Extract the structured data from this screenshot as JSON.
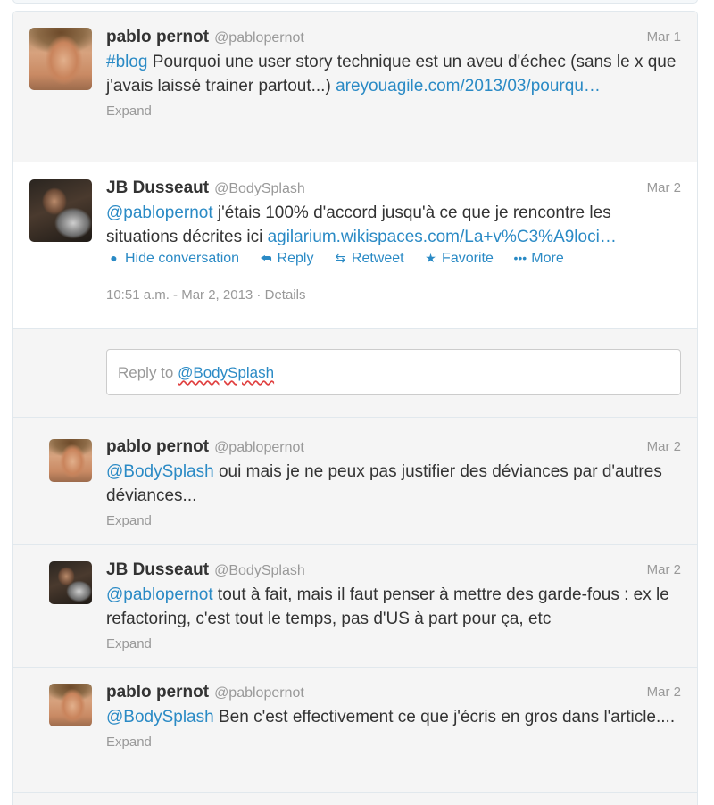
{
  "tweets": [
    {
      "fullname": "pablo pernot",
      "username": "@pablopernot",
      "date": "Mar 1",
      "text_parts": [
        "#blog",
        " Pourquoi une user story technique est un aveu d'échec (sans le x que j'avais laissé trainer partout...) ",
        "areyouagile.com/2013/03/pourqu…"
      ],
      "expand": "Expand"
    },
    {
      "fullname": "JB Dusseaut",
      "username": "@BodySplash",
      "date": "Mar 2",
      "text_parts": [
        "@pablopernot",
        " j'étais 100% d'accord jusqu'à ce que je rencontre les situations décrites ici ",
        "agilarium.wikispaces.com/La+v%C3%A9loci…"
      ],
      "actions": {
        "hide_conversation": "Hide conversation",
        "reply": "Reply",
        "retweet": "Retweet",
        "favorite": "Favorite",
        "more": "More"
      },
      "timestamp": "10:51 a.m. - Mar 2, 2013",
      "details": "Details"
    },
    {
      "fullname": "pablo pernot",
      "username": "@pablopernot",
      "date": "Mar 2",
      "text_parts": [
        "@BodySplash",
        " oui mais je ne peux pas justifier des déviances par d'autres déviances..."
      ],
      "expand": "Expand"
    },
    {
      "fullname": "JB Dusseaut",
      "username": "@BodySplash",
      "date": "Mar 2",
      "text_parts": [
        "@pablopernot",
        " tout à fait, mais il faut penser à mettre des garde-fous : ex le refactoring, c'est tout le temps, pas d'US à part pour ça, etc"
      ],
      "expand": "Expand"
    },
    {
      "fullname": "pablo pernot",
      "username": "@pablopernot",
      "date": "Mar 2",
      "text_parts": [
        "@BodySplash",
        " Ben c'est effectivement ce que j'écris en gros dans l'article...."
      ],
      "expand": "Expand"
    }
  ],
  "reply_box": {
    "prefix": "Reply to ",
    "mention": "@BodySplash"
  },
  "colors": {
    "link": "#2a8ac5",
    "muted": "#999999",
    "text": "#333333",
    "border": "#e1e8ed",
    "grey_bg": "#f5f5f5"
  },
  "icons": {
    "hide_conversation": "speech-bubble-icon",
    "reply": "reply-arrow-icon",
    "retweet": "retweet-icon",
    "favorite": "star-icon",
    "more": "ellipsis-icon"
  }
}
